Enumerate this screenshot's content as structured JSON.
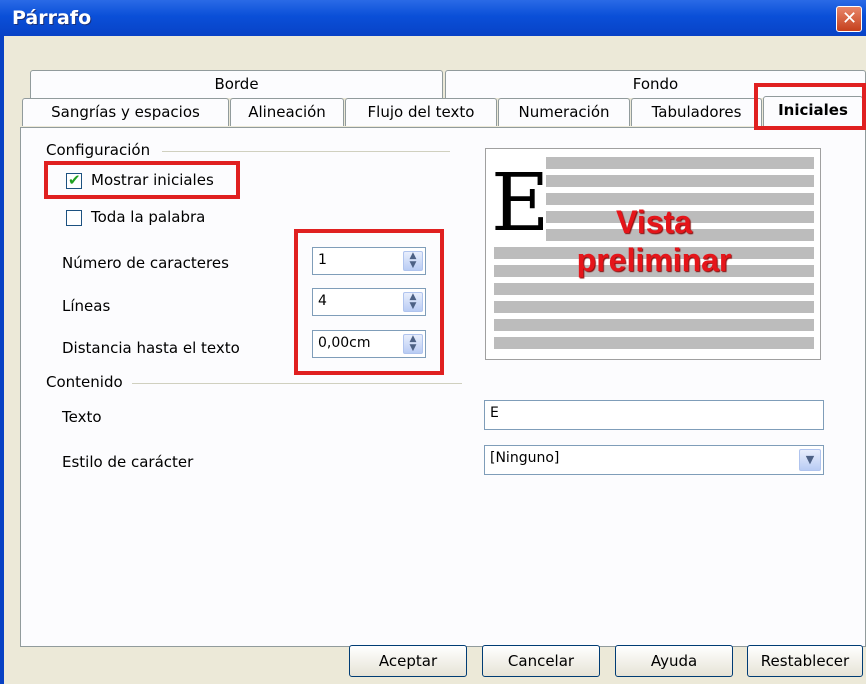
{
  "window": {
    "title": "Párrafo"
  },
  "tabs": {
    "row1": [
      "Borde",
      "Fondo"
    ],
    "row2": [
      "Sangrías y espacios",
      "Alineación",
      "Flujo del texto",
      "Numeración",
      "Tabuladores",
      "Iniciales"
    ],
    "active": "Iniciales"
  },
  "config": {
    "group_label": "Configuración",
    "show_initials": {
      "label": "Mostrar iniciales",
      "checked": true
    },
    "whole_word": {
      "label": "Toda la palabra",
      "checked": false
    },
    "num_chars": {
      "label": "Número de caracteres",
      "value": "1"
    },
    "lines": {
      "label": "Líneas",
      "value": "4"
    },
    "distance": {
      "label": "Distancia hasta el texto",
      "value": "0,00cm"
    }
  },
  "preview": {
    "dropcap_letter": "E",
    "overlay_line1": "Vista",
    "overlay_line2": "preliminar"
  },
  "content": {
    "group_label": "Contenido",
    "text": {
      "label": "Texto",
      "value": "E"
    },
    "char_style": {
      "label": "Estilo de carácter",
      "value": "[Ninguno]"
    }
  },
  "buttons": {
    "ok": "Aceptar",
    "cancel": "Cancelar",
    "help": "Ayuda",
    "reset": "Restablecer"
  },
  "colors": {
    "titlebar": "#0a4fd8",
    "highlight": "#e02020",
    "preview_text": "#e5151a",
    "checkmark": "#21a121"
  },
  "icons": {
    "close": "close-icon",
    "spin": "spin-arrows-icon",
    "dropdown": "chevron-down-icon",
    "check": "checkmark-icon"
  }
}
